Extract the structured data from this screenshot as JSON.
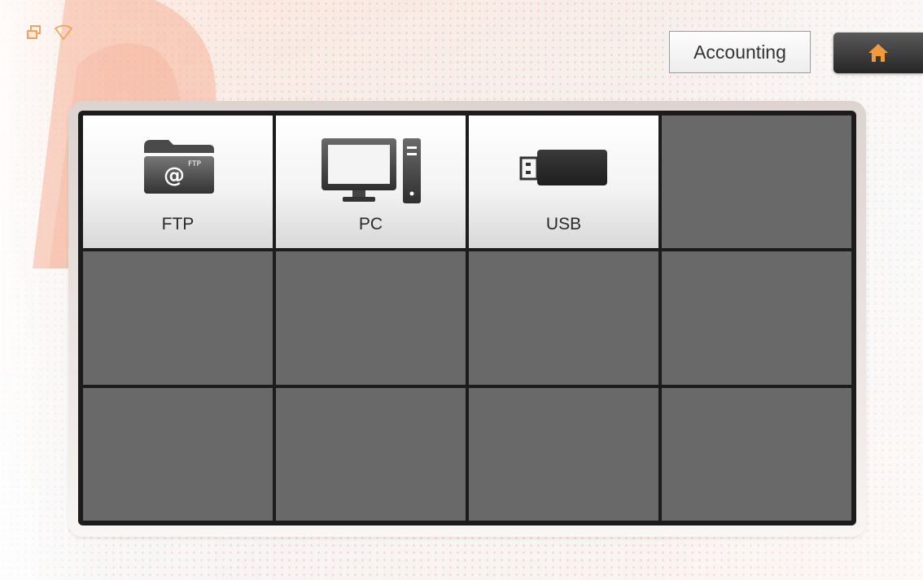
{
  "header": {
    "profile_label": "Accounting",
    "home_icon": "home-icon"
  },
  "status_icons": [
    "profile-switch-icon",
    "wifi-icon"
  ],
  "destinations": [
    {
      "label": "FTP",
      "icon": "ftp-folder-icon"
    },
    {
      "label": "PC",
      "icon": "pc-icon"
    },
    {
      "label": "USB",
      "icon": "usb-drive-icon"
    }
  ],
  "empty_tiles": 9,
  "colors": {
    "accent": "#f29a38",
    "tile_empty": "#696969",
    "grid_border": "#1c1c1c"
  }
}
